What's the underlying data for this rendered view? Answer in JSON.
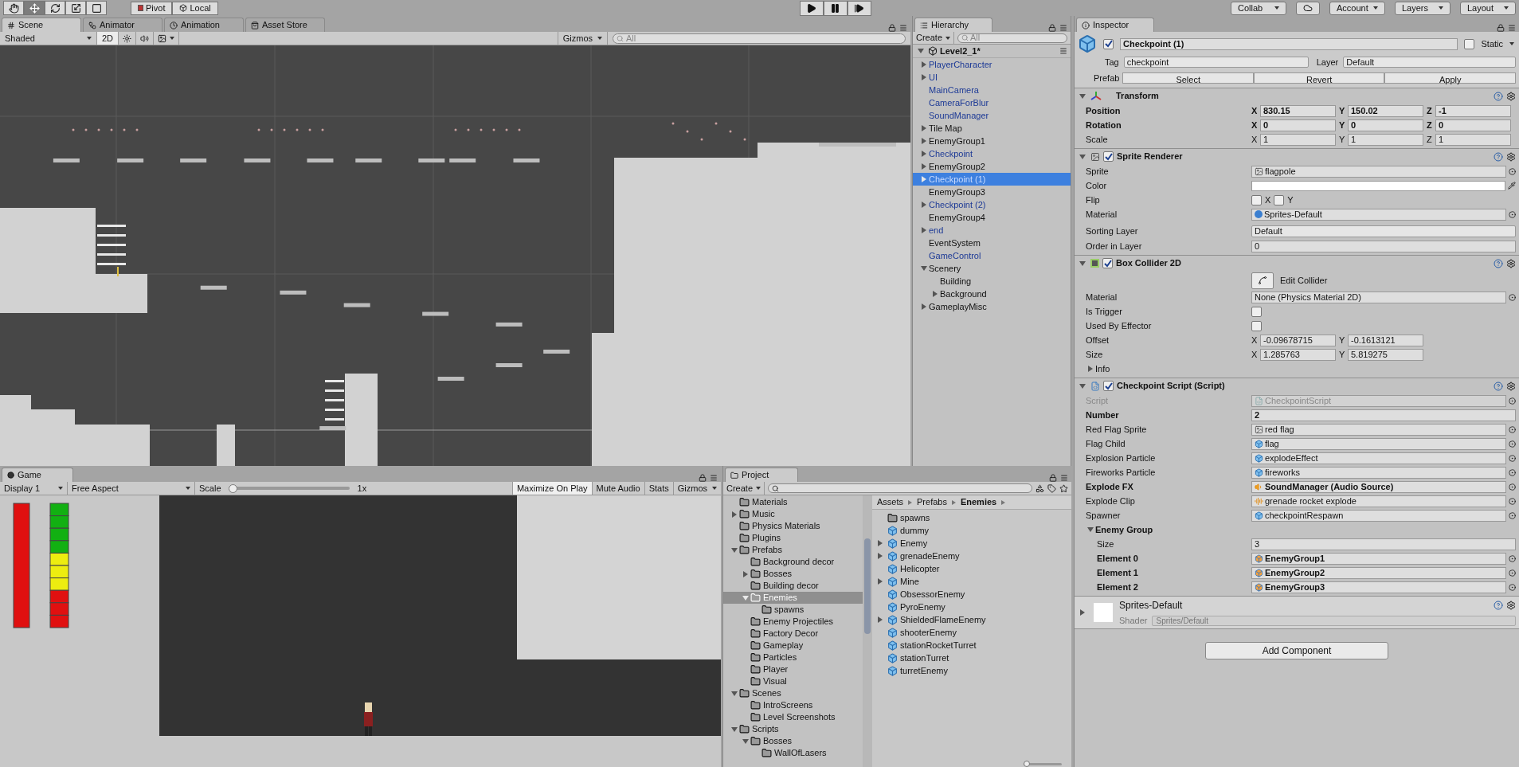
{
  "toolbar": {
    "tools": [
      {
        "kind": "hand",
        "selected": false
      },
      {
        "kind": "move",
        "selected": true
      },
      {
        "kind": "rotate",
        "selected": false
      },
      {
        "kind": "scale",
        "selected": false
      },
      {
        "kind": "rect",
        "selected": false
      }
    ],
    "handle_buttons": [
      {
        "kind": "pivot",
        "label": "Pivot"
      },
      {
        "kind": "local",
        "label": "Local"
      }
    ],
    "menus": [
      {
        "kind": "menu",
        "label": "Collab"
      },
      {
        "kind": "cloud"
      },
      {
        "kind": "menu",
        "label": "Account"
      },
      {
        "kind": "menu",
        "label": "Layers"
      },
      {
        "kind": "menu",
        "label": "Layout"
      }
    ]
  },
  "scene_panel": {
    "tabs": [
      {
        "label": "Scene",
        "selected": true
      },
      {
        "label": "Animator",
        "selected": false
      },
      {
        "label": "Animation",
        "selected": false
      },
      {
        "label": "Asset Store",
        "selected": false
      }
    ],
    "shading": "Shaded",
    "mode_2d": {
      "label": "2D",
      "on": true
    },
    "gizmos": "Gizmos",
    "search": {
      "placeholder": "All"
    }
  },
  "game_panel": {
    "tab": "Game",
    "display": "Display 1",
    "aspect": "Free Aspect",
    "scale": {
      "label": "Scale",
      "level": 0,
      "reading": "1x"
    },
    "toggles": [
      {
        "label": "Maximize On Play",
        "on": true
      },
      {
        "label": "Mute Audio",
        "on": false
      },
      {
        "label": "Stats",
        "on": false
      }
    ],
    "gizmos": "Gizmos"
  },
  "hierarchy": {
    "tab": "Hierarchy",
    "create": "Create",
    "search": {
      "placeholder": "All"
    },
    "scene": "Level2_1*",
    "items": [
      {
        "name": "PlayerCharacter",
        "prefab": true,
        "expandable": true,
        "expanded": false,
        "selected": false
      },
      {
        "name": "UI",
        "prefab": true,
        "expandable": true,
        "expanded": false,
        "selected": false
      },
      {
        "name": "MainCamera",
        "prefab": true,
        "expandable": false,
        "selected": false
      },
      {
        "name": "CameraForBlur",
        "prefab": true,
        "expandable": false,
        "selected": false
      },
      {
        "name": "SoundManager",
        "prefab": true,
        "expandable": false,
        "selected": false
      },
      {
        "name": "Tile Map",
        "prefab": false,
        "expandable": true,
        "expanded": false,
        "selected": false
      },
      {
        "name": "EnemyGroup1",
        "prefab": false,
        "expandable": true,
        "expanded": false,
        "selected": false
      },
      {
        "name": "Checkpoint",
        "prefab": true,
        "expandable": true,
        "expanded": false,
        "selected": false
      },
      {
        "name": "EnemyGroup2",
        "prefab": false,
        "expandable": true,
        "expanded": false,
        "selected": false
      },
      {
        "name": "Checkpoint (1)",
        "prefab": true,
        "expandable": true,
        "expanded": false,
        "selected": true
      },
      {
        "name": "EnemyGroup3",
        "prefab": false,
        "expandable": false,
        "selected": false
      },
      {
        "name": "Checkpoint (2)",
        "prefab": true,
        "expandable": true,
        "expanded": false,
        "selected": false
      },
      {
        "name": "EnemyGroup4",
        "prefab": false,
        "expandable": false,
        "selected": false
      },
      {
        "name": "end",
        "prefab": true,
        "expandable": true,
        "expanded": false,
        "selected": false
      },
      {
        "name": "EventSystem",
        "prefab": false,
        "expandable": false,
        "selected": false
      },
      {
        "name": "GameControl",
        "prefab": true,
        "expandable": false,
        "selected": false
      },
      {
        "name": "Scenery",
        "prefab": false,
        "expandable": true,
        "expanded": true,
        "selected": false,
        "children": [
          {
            "name": "Building",
            "prefab": false,
            "expandable": false,
            "selected": false
          },
          {
            "name": "Background",
            "prefab": false,
            "expandable": true,
            "expanded": false,
            "selected": false
          }
        ]
      },
      {
        "name": "GameplayMisc",
        "prefab": false,
        "expandable": true,
        "expanded": false,
        "selected": false
      }
    ]
  },
  "project": {
    "tab": "Project",
    "create": "Create",
    "folders": [
      {
        "name": "Materials",
        "expandable": false,
        "selected": false
      },
      {
        "name": "Music",
        "expandable": true,
        "expanded": false,
        "selected": false
      },
      {
        "name": "Physics Materials",
        "expandable": false,
        "selected": false
      },
      {
        "name": "Plugins",
        "expandable": false,
        "selected": false
      },
      {
        "name": "Prefabs",
        "expandable": true,
        "expanded": true,
        "selected": false,
        "children": [
          {
            "name": "Background decor",
            "expandable": false,
            "selected": false
          },
          {
            "name": "Bosses",
            "expandable": true,
            "expanded": false,
            "selected": false
          },
          {
            "name": "Building decor",
            "expandable": false,
            "selected": false
          },
          {
            "name": "Enemies",
            "expandable": true,
            "expanded": true,
            "selected": true,
            "children": [
              {
                "name": "spawns",
                "expandable": false,
                "selected": false
              }
            ]
          },
          {
            "name": "Enemy Projectiles",
            "expandable": false,
            "selected": false
          },
          {
            "name": "Factory Decor",
            "expandable": false,
            "selected": false
          },
          {
            "name": "Gameplay",
            "expandable": false,
            "selected": false
          },
          {
            "name": "Particles",
            "expandable": false,
            "selected": false
          },
          {
            "name": "Player",
            "expandable": false,
            "selected": false
          },
          {
            "name": "Visual",
            "expandable": false,
            "selected": false
          }
        ]
      },
      {
        "name": "Scenes",
        "expandable": true,
        "expanded": true,
        "selected": false,
        "children": [
          {
            "name": "IntroScreens",
            "expandable": false,
            "selected": false
          },
          {
            "name": "Level Screenshots",
            "expandable": false,
            "selected": false
          }
        ]
      },
      {
        "name": "Scripts",
        "expandable": true,
        "expanded": true,
        "selected": false,
        "children": [
          {
            "name": "Bosses",
            "expandable": true,
            "expanded": true,
            "selected": false,
            "children": [
              {
                "name": "WallOfLasers",
                "expandable": false,
                "selected": false
              }
            ]
          }
        ]
      }
    ],
    "breadcrumb": [
      "Assets",
      "Prefabs",
      "Enemies"
    ],
    "assets": [
      {
        "name": "spawns",
        "kind": "folder",
        "expandable": false
      },
      {
        "name": "dummy",
        "kind": "prefab",
        "expandable": false
      },
      {
        "name": "Enemy",
        "kind": "prefab",
        "expandable": true,
        "expanded": false
      },
      {
        "name": "grenadeEnemy",
        "kind": "prefab",
        "expandable": true,
        "expanded": false
      },
      {
        "name": "Helicopter",
        "kind": "prefab",
        "expandable": false
      },
      {
        "name": "Mine",
        "kind": "prefab",
        "expandable": true,
        "expanded": false
      },
      {
        "name": "ObsessorEnemy",
        "kind": "prefab",
        "expandable": false
      },
      {
        "name": "PyroEnemy",
        "kind": "prefab",
        "expandable": false
      },
      {
        "name": "ShieldedFlameEnemy",
        "kind": "prefab",
        "expandable": true,
        "expanded": false
      },
      {
        "name": "shooterEnemy",
        "kind": "prefab",
        "expandable": false
      },
      {
        "name": "stationRocketTurret",
        "kind": "prefab",
        "expandable": false
      },
      {
        "name": "stationTurret",
        "kind": "prefab",
        "expandable": false
      },
      {
        "name": "turretEnemy",
        "kind": "prefab",
        "expandable": false
      }
    ],
    "icon_size": {
      "level": 0
    }
  },
  "inspector": {
    "tab": "Inspector",
    "object": {
      "name": "Checkpoint (1)",
      "active": true,
      "static": {
        "label": "Static",
        "checked": false
      },
      "tag": {
        "label": "Tag",
        "value": "checkpoint"
      },
      "layer": {
        "label": "Layer",
        "value": "Default"
      },
      "prefab": {
        "label": "Prefab",
        "buttons": [
          "Select",
          "Revert",
          "Apply"
        ]
      }
    },
    "components": [
      {
        "title": "Transform",
        "kind": "transform",
        "expanded": true,
        "rows": [
          {
            "kind": "vector",
            "label": "Position",
            "overridden": true,
            "values": [
              {
                "axis": "X",
                "value": "830.15"
              },
              {
                "axis": "Y",
                "value": "150.02"
              },
              {
                "axis": "Z",
                "value": "-1"
              }
            ]
          },
          {
            "kind": "vector",
            "label": "Rotation",
            "overridden": true,
            "values": [
              {
                "axis": "X",
                "value": "0"
              },
              {
                "axis": "Y",
                "value": "0"
              },
              {
                "axis": "Z",
                "value": "0"
              }
            ]
          },
          {
            "kind": "vector",
            "label": "Scale",
            "overridden": false,
            "values": [
              {
                "axis": "X",
                "value": "1"
              },
              {
                "axis": "Y",
                "value": "1"
              },
              {
                "axis": "Z",
                "value": "1"
              }
            ]
          }
        ]
      },
      {
        "title": "Sprite Renderer",
        "kind": "sprite_renderer",
        "enabled": true,
        "expanded": true,
        "rows": [
          {
            "kind": "sprite_ref",
            "label": "Sprite",
            "value": "flagpole",
            "overridden": false
          },
          {
            "kind": "color",
            "label": "Color",
            "color": "#ffffff"
          },
          {
            "kind": "flip",
            "label": "Flip",
            "options": [
              {
                "label": "X",
                "checked": false
              },
              {
                "label": "Y",
                "checked": false
              }
            ]
          },
          {
            "kind": "material_ref",
            "label": "Material",
            "value": "Sprites-Default",
            "overridden": false
          },
          {
            "kind": "dropdown",
            "label": "Sorting Layer",
            "value": "Default"
          },
          {
            "kind": "field",
            "label": "Order in Layer",
            "value": "0",
            "overridden": false
          }
        ]
      },
      {
        "title": "Box Collider 2D",
        "kind": "box_collider",
        "enabled": true,
        "expanded": true,
        "rows": [
          {
            "kind": "button",
            "label": "Edit Collider"
          },
          {
            "kind": "empty_ref",
            "label": "Material",
            "value": "None (Physics Material 2D)",
            "overridden": false
          },
          {
            "kind": "checkbox",
            "label": "Is Trigger",
            "checked": false
          },
          {
            "kind": "checkbox",
            "label": "Used By Effector",
            "checked": false
          },
          {
            "kind": "vector",
            "label": "Offset",
            "overridden": false,
            "values": [
              {
                "axis": "X",
                "value": "-0.09678715"
              },
              {
                "axis": "Y",
                "value": "-0.1613121"
              }
            ]
          },
          {
            "kind": "vector",
            "label": "Size",
            "overridden": false,
            "values": [
              {
                "axis": "X",
                "value": "1.285763"
              },
              {
                "axis": "Y",
                "value": "5.819275"
              }
            ]
          },
          {
            "kind": "foldout",
            "label": "Info",
            "expanded": false,
            "overridden": false
          }
        ]
      },
      {
        "title": "Checkpoint Script (Script)",
        "kind": "script",
        "enabled": true,
        "expanded": true,
        "rows": [
          {
            "kind": "script_ref",
            "label": "Script",
            "value": "CheckpointScript",
            "overridden": false,
            "disabled": true
          },
          {
            "kind": "field",
            "label": "Number",
            "value": "2",
            "overridden": true
          },
          {
            "kind": "sprite_ref",
            "label": "Red Flag Sprite",
            "value": "red flag",
            "overridden": false
          },
          {
            "kind": "prefab_ref",
            "label": "Flag Child",
            "value": "flag",
            "overridden": false
          },
          {
            "kind": "prefab_ref",
            "label": "Explosion Particle",
            "value": "explodeEffect",
            "overridden": false
          },
          {
            "kind": "prefab_ref",
            "label": "Fireworks Particle",
            "value": "fireworks",
            "overridden": false
          },
          {
            "kind": "audio_ref",
            "label": "Explode FX",
            "value": "SoundManager (Audio Source)",
            "overridden": true
          },
          {
            "kind": "clip_ref",
            "label": "Explode Clip",
            "value": "grenade rocket explode",
            "overridden": false
          },
          {
            "kind": "prefab_ref",
            "label": "Spawner",
            "value": "checkpointRespawn",
            "overridden": false
          },
          {
            "kind": "foldout",
            "label": "Enemy Group",
            "expanded": true,
            "overridden": true,
            "children": [
              {
                "kind": "field",
                "label": "Size",
                "value": "3",
                "overridden": false
              },
              {
                "kind": "object_ref",
                "label": "Element 0",
                "value": "EnemyGroup1",
                "overridden": true
              },
              {
                "kind": "object_ref",
                "label": "Element 1",
                "value": "EnemyGroup2",
                "overridden": true
              },
              {
                "kind": "object_ref",
                "label": "Element 2",
                "value": "EnemyGroup3",
                "overridden": true
              }
            ]
          }
        ]
      }
    ],
    "material": {
      "name": "Sprites-Default",
      "expanded": false,
      "shader": {
        "label": "Shader",
        "value": "Sprites/Default"
      }
    },
    "add_component": "Add Component"
  }
}
